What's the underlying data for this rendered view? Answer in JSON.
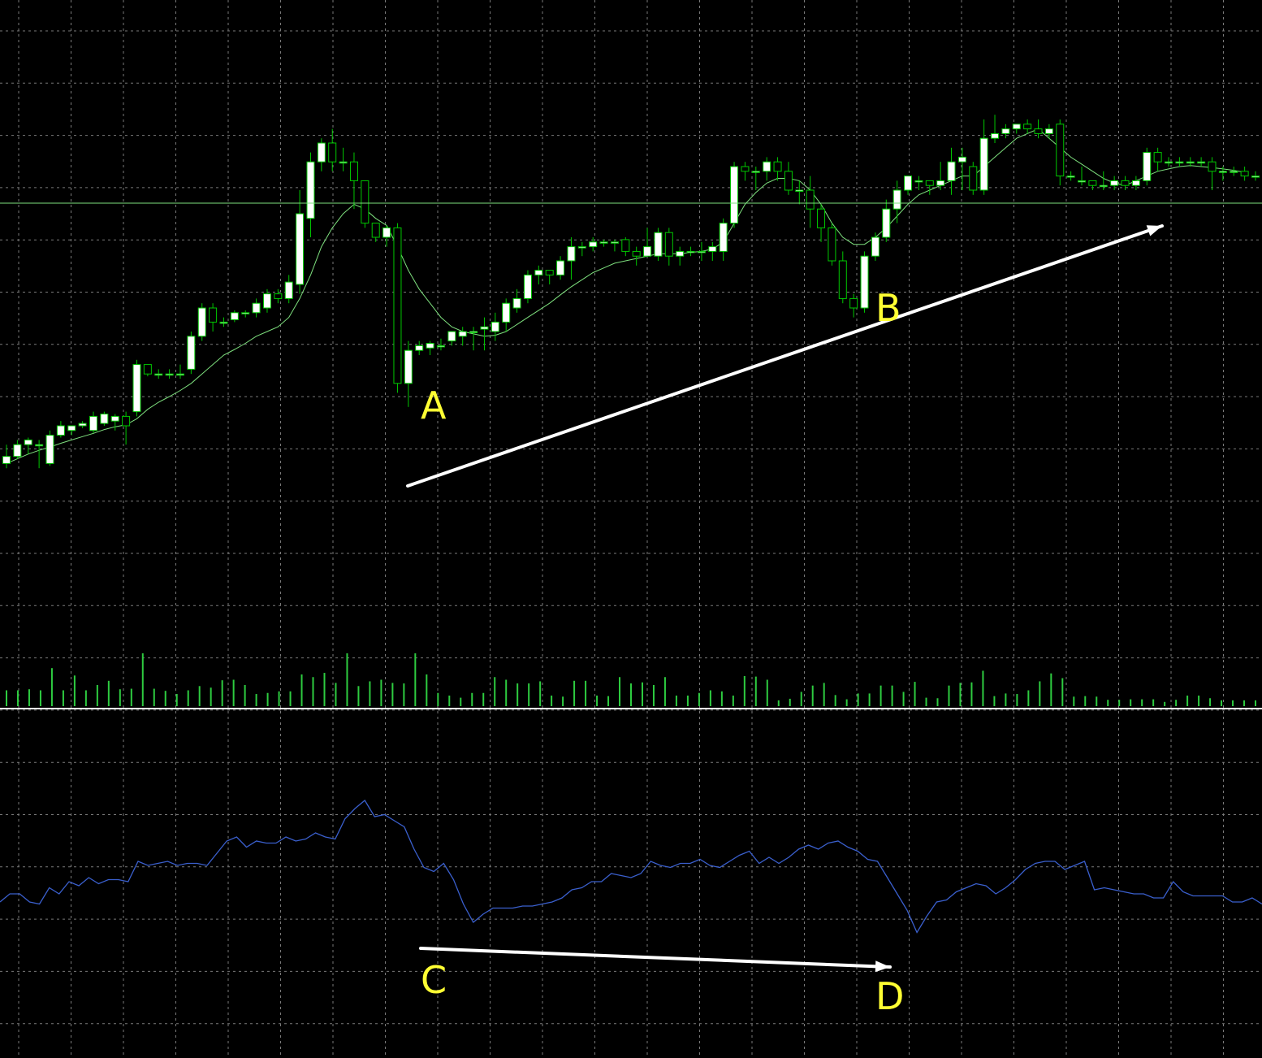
{
  "theme": {
    "background": "#000000",
    "grid_color": "#7a7a7a",
    "bull_color": "#ffffff",
    "bear_color": "#000000",
    "wick_color": "#00c800",
    "ma_color": "#7ee07e",
    "volume_color": "#2ecc40",
    "indicator_color": "#3a5fcd",
    "annotation_color": "#ffff33",
    "arrow_color": "#ffffff",
    "separator_color": "#ffffff"
  },
  "annotations": {
    "A": "A",
    "B": "B",
    "C": "C",
    "D": "D"
  },
  "chart_data": [
    {
      "type": "candlestick",
      "title": "",
      "grid": true,
      "ylim": [
        0,
        1
      ],
      "series": [
        {
          "name": "",
          "ohlc": [
            [
              0.12,
              0.135,
              0.11,
              0.16
            ],
            [
              0.135,
              0.16,
              0.13,
              0.17
            ],
            [
              0.16,
              0.17,
              0.14,
              0.175
            ],
            [
              0.16,
              0.16,
              0.11,
              0.17
            ],
            [
              0.12,
              0.18,
              0.115,
              0.19
            ],
            [
              0.18,
              0.2,
              0.175,
              0.21
            ],
            [
              0.19,
              0.2,
              0.18,
              0.2
            ],
            [
              0.2,
              0.205,
              0.195,
              0.21
            ],
            [
              0.19,
              0.22,
              0.185,
              0.23
            ],
            [
              0.205,
              0.225,
              0.2,
              0.23
            ],
            [
              0.21,
              0.22,
              0.19,
              0.225
            ],
            [
              0.22,
              0.2,
              0.16,
              0.23
            ],
            [
              0.23,
              0.33,
              0.22,
              0.34
            ],
            [
              0.33,
              0.31,
              0.305,
              0.33
            ],
            [
              0.31,
              0.31,
              0.3,
              0.32
            ],
            [
              0.31,
              0.31,
              0.3,
              0.32
            ],
            [
              0.31,
              0.31,
              0.3,
              0.33
            ],
            [
              0.32,
              0.39,
              0.31,
              0.4
            ],
            [
              0.39,
              0.45,
              0.38,
              0.46
            ],
            [
              0.45,
              0.42,
              0.4,
              0.46
            ],
            [
              0.42,
              0.42,
              0.41,
              0.43
            ],
            [
              0.425,
              0.44,
              0.42,
              0.445
            ],
            [
              0.44,
              0.44,
              0.43,
              0.445
            ],
            [
              0.44,
              0.46,
              0.43,
              0.47
            ],
            [
              0.45,
              0.48,
              0.44,
              0.49
            ],
            [
              0.48,
              0.47,
              0.46,
              0.49
            ],
            [
              0.47,
              0.505,
              0.46,
              0.52
            ],
            [
              0.5,
              0.65,
              0.48,
              0.7
            ],
            [
              0.64,
              0.76,
              0.6,
              0.78
            ],
            [
              0.76,
              0.8,
              0.74,
              0.81
            ],
            [
              0.8,
              0.76,
              0.74,
              0.83
            ],
            [
              0.76,
              0.76,
              0.74,
              0.79
            ],
            [
              0.76,
              0.72,
              0.66,
              0.78
            ],
            [
              0.72,
              0.63,
              0.62,
              0.72
            ],
            [
              0.63,
              0.6,
              0.59,
              0.61
            ],
            [
              0.6,
              0.62,
              0.58,
              0.625
            ],
            [
              0.62,
              0.29,
              0.27,
              0.63
            ],
            [
              0.29,
              0.36,
              0.24,
              0.38
            ],
            [
              0.36,
              0.37,
              0.35,
              0.38
            ],
            [
              0.365,
              0.375,
              0.35,
              0.38
            ],
            [
              0.37,
              0.37,
              0.36,
              0.385
            ],
            [
              0.38,
              0.4,
              0.37,
              0.4
            ],
            [
              0.39,
              0.4,
              0.37,
              0.41
            ],
            [
              0.4,
              0.4,
              0.36,
              0.41
            ],
            [
              0.405,
              0.41,
              0.36,
              0.43
            ],
            [
              0.4,
              0.42,
              0.38,
              0.44
            ],
            [
              0.42,
              0.46,
              0.4,
              0.47
            ],
            [
              0.45,
              0.47,
              0.44,
              0.49
            ],
            [
              0.47,
              0.52,
              0.46,
              0.53
            ],
            [
              0.52,
              0.53,
              0.5,
              0.54
            ],
            [
              0.53,
              0.52,
              0.5,
              0.53
            ],
            [
              0.52,
              0.55,
              0.51,
              0.56
            ],
            [
              0.55,
              0.58,
              0.51,
              0.6
            ],
            [
              0.58,
              0.58,
              0.56,
              0.59
            ],
            [
              0.58,
              0.59,
              0.57,
              0.6
            ],
            [
              0.59,
              0.59,
              0.58,
              0.595
            ],
            [
              0.59,
              0.59,
              0.57,
              0.595
            ],
            [
              0.595,
              0.57,
              0.56,
              0.6
            ],
            [
              0.57,
              0.56,
              0.54,
              0.58
            ],
            [
              0.56,
              0.58,
              0.56,
              0.62
            ],
            [
              0.56,
              0.61,
              0.55,
              0.62
            ],
            [
              0.61,
              0.56,
              0.54,
              0.62
            ],
            [
              0.56,
              0.57,
              0.54,
              0.58
            ],
            [
              0.57,
              0.57,
              0.56,
              0.58
            ],
            [
              0.57,
              0.57,
              0.55,
              0.59
            ],
            [
              0.57,
              0.58,
              0.55,
              0.59
            ],
            [
              0.57,
              0.63,
              0.55,
              0.64
            ],
            [
              0.63,
              0.75,
              0.62,
              0.76
            ],
            [
              0.75,
              0.74,
              0.72,
              0.76
            ],
            [
              0.74,
              0.74,
              0.7,
              0.75
            ],
            [
              0.74,
              0.76,
              0.72,
              0.77
            ],
            [
              0.76,
              0.74,
              0.72,
              0.77
            ],
            [
              0.74,
              0.7,
              0.69,
              0.76
            ],
            [
              0.7,
              0.7,
              0.67,
              0.72
            ],
            [
              0.7,
              0.66,
              0.62,
              0.73
            ],
            [
              0.66,
              0.62,
              0.59,
              0.67
            ],
            [
              0.62,
              0.55,
              0.54,
              0.63
            ],
            [
              0.55,
              0.47,
              0.46,
              0.57
            ],
            [
              0.47,
              0.45,
              0.43,
              0.48
            ],
            [
              0.45,
              0.56,
              0.44,
              0.57
            ],
            [
              0.56,
              0.6,
              0.55,
              0.61
            ],
            [
              0.6,
              0.66,
              0.59,
              0.68
            ],
            [
              0.66,
              0.7,
              0.63,
              0.72
            ],
            [
              0.7,
              0.73,
              0.69,
              0.73
            ],
            [
              0.72,
              0.72,
              0.7,
              0.73
            ],
            [
              0.72,
              0.71,
              0.69,
              0.72
            ],
            [
              0.71,
              0.72,
              0.7,
              0.76
            ],
            [
              0.72,
              0.76,
              0.69,
              0.79
            ],
            [
              0.76,
              0.77,
              0.7,
              0.79
            ],
            [
              0.75,
              0.7,
              0.69,
              0.76
            ],
            [
              0.7,
              0.81,
              0.69,
              0.85
            ],
            [
              0.81,
              0.82,
              0.8,
              0.86
            ],
            [
              0.82,
              0.83,
              0.81,
              0.84
            ],
            [
              0.83,
              0.84,
              0.82,
              0.84
            ],
            [
              0.84,
              0.83,
              0.82,
              0.85
            ],
            [
              0.83,
              0.82,
              0.81,
              0.85
            ],
            [
              0.82,
              0.83,
              0.81,
              0.84
            ],
            [
              0.84,
              0.73,
              0.71,
              0.85
            ],
            [
              0.73,
              0.73,
              0.72,
              0.74
            ],
            [
              0.72,
              0.72,
              0.71,
              0.75
            ],
            [
              0.72,
              0.71,
              0.7,
              0.72
            ],
            [
              0.71,
              0.71,
              0.7,
              0.74
            ],
            [
              0.71,
              0.72,
              0.7,
              0.73
            ],
            [
              0.72,
              0.71,
              0.7,
              0.73
            ],
            [
              0.71,
              0.72,
              0.7,
              0.73
            ],
            [
              0.72,
              0.78,
              0.71,
              0.79
            ],
            [
              0.78,
              0.76,
              0.74,
              0.79
            ],
            [
              0.76,
              0.76,
              0.75,
              0.77
            ],
            [
              0.76,
              0.76,
              0.75,
              0.77
            ],
            [
              0.76,
              0.76,
              0.75,
              0.77
            ],
            [
              0.76,
              0.76,
              0.75,
              0.77
            ],
            [
              0.76,
              0.74,
              0.7,
              0.77
            ],
            [
              0.74,
              0.74,
              0.72,
              0.75
            ],
            [
              0.74,
              0.74,
              0.73,
              0.75
            ],
            [
              0.74,
              0.73,
              0.72,
              0.75
            ],
            [
              0.73,
              0.73,
              0.72,
              0.74
            ]
          ],
          "moving_average": [
            0.12,
            0.13,
            0.14,
            0.148,
            0.155,
            0.163,
            0.17,
            0.177,
            0.184,
            0.192,
            0.198,
            0.202,
            0.215,
            0.235,
            0.25,
            0.262,
            0.275,
            0.29,
            0.31,
            0.33,
            0.35,
            0.362,
            0.375,
            0.39,
            0.4,
            0.41,
            0.43,
            0.47,
            0.52,
            0.58,
            0.62,
            0.65,
            0.67,
            0.66,
            0.64,
            0.625,
            0.58,
            0.53,
            0.49,
            0.46,
            0.43,
            0.41,
            0.4,
            0.395,
            0.39,
            0.392,
            0.4,
            0.415,
            0.43,
            0.445,
            0.46,
            0.478,
            0.495,
            0.51,
            0.525,
            0.535,
            0.545,
            0.55,
            0.555,
            0.56,
            0.565,
            0.565,
            0.565,
            0.568,
            0.57,
            0.575,
            0.59,
            0.63,
            0.67,
            0.695,
            0.715,
            0.725,
            0.725,
            0.72,
            0.7,
            0.67,
            0.63,
            0.6,
            0.585,
            0.585,
            0.6,
            0.62,
            0.645,
            0.67,
            0.69,
            0.7,
            0.71,
            0.72,
            0.73,
            0.73,
            0.75,
            0.77,
            0.79,
            0.81,
            0.82,
            0.83,
            0.81,
            0.79,
            0.77,
            0.755,
            0.74,
            0.725,
            0.715,
            0.71,
            0.72,
            0.73,
            0.74,
            0.745,
            0.75,
            0.752,
            0.75,
            0.748,
            0.745,
            0.742,
            0.738
          ]
        }
      ]
    },
    {
      "type": "bar",
      "title": "",
      "grid": true,
      "ylim": [
        0,
        1
      ],
      "values": [
        0.3,
        0.3,
        0.32,
        0.3,
        0.72,
        0.3,
        0.58,
        0.3,
        0.4,
        0.48,
        0.32,
        0.33,
        1.0,
        0.33,
        0.29,
        0.23,
        0.3,
        0.38,
        0.35,
        0.49,
        0.5,
        0.4,
        0.23,
        0.25,
        0.28,
        0.28,
        0.6,
        0.55,
        0.63,
        0.44,
        1.0,
        0.38,
        0.47,
        0.5,
        0.44,
        0.43,
        1.0,
        0.6,
        0.25,
        0.2,
        0.16,
        0.25,
        0.25,
        0.55,
        0.5,
        0.43,
        0.43,
        0.47,
        0.2,
        0.18,
        0.48,
        0.48,
        0.2,
        0.19,
        0.55,
        0.43,
        0.45,
        0.4,
        0.55,
        0.2,
        0.2,
        0.25,
        0.3,
        0.28,
        0.2,
        0.57,
        0.56,
        0.5,
        0.11,
        0.14,
        0.27,
        0.39,
        0.44,
        0.21,
        0.13,
        0.24,
        0.24,
        0.39,
        0.39,
        0.27,
        0.46,
        0.16,
        0.15,
        0.39,
        0.44,
        0.45,
        0.67,
        0.19,
        0.24,
        0.23,
        0.3,
        0.47,
        0.62,
        0.53,
        0.18,
        0.19,
        0.18,
        0.12,
        0.12,
        0.13,
        0.13,
        0.13,
        0.08,
        0.12,
        0.2,
        0.2,
        0.15,
        0.11,
        0.11,
        0.11,
        0.11
      ]
    },
    {
      "type": "line",
      "title": "",
      "grid": true,
      "ylim": [
        0,
        1
      ],
      "series": [
        {
          "name": "",
          "values": [
            0.36,
            0.4,
            0.4,
            0.36,
            0.35,
            0.43,
            0.4,
            0.46,
            0.44,
            0.48,
            0.45,
            0.47,
            0.47,
            0.46,
            0.56,
            0.54,
            0.55,
            0.56,
            0.54,
            0.55,
            0.55,
            0.54,
            0.6,
            0.66,
            0.68,
            0.63,
            0.66,
            0.65,
            0.65,
            0.68,
            0.66,
            0.67,
            0.7,
            0.68,
            0.67,
            0.77,
            0.82,
            0.86,
            0.78,
            0.79,
            0.76,
            0.73,
            0.62,
            0.53,
            0.51,
            0.55,
            0.47,
            0.35,
            0.26,
            0.3,
            0.33,
            0.33,
            0.33,
            0.34,
            0.34,
            0.35,
            0.36,
            0.38,
            0.42,
            0.43,
            0.46,
            0.46,
            0.5,
            0.49,
            0.48,
            0.5,
            0.56,
            0.54,
            0.53,
            0.55,
            0.55,
            0.57,
            0.54,
            0.53,
            0.56,
            0.59,
            0.61,
            0.55,
            0.58,
            0.55,
            0.58,
            0.62,
            0.64,
            0.62,
            0.65,
            0.66,
            0.63,
            0.61,
            0.57,
            0.56,
            0.48,
            0.4,
            0.32,
            0.21,
            0.29,
            0.36,
            0.37,
            0.41,
            0.43,
            0.45,
            0.44,
            0.4,
            0.43,
            0.47,
            0.52,
            0.55,
            0.56,
            0.56,
            0.52,
            0.54,
            0.56,
            0.42,
            0.43,
            0.42,
            0.41,
            0.4,
            0.4,
            0.38,
            0.38,
            0.46,
            0.41,
            0.39,
            0.39,
            0.39,
            0.39,
            0.36,
            0.36,
            0.38,
            0.35
          ]
        }
      ]
    }
  ]
}
